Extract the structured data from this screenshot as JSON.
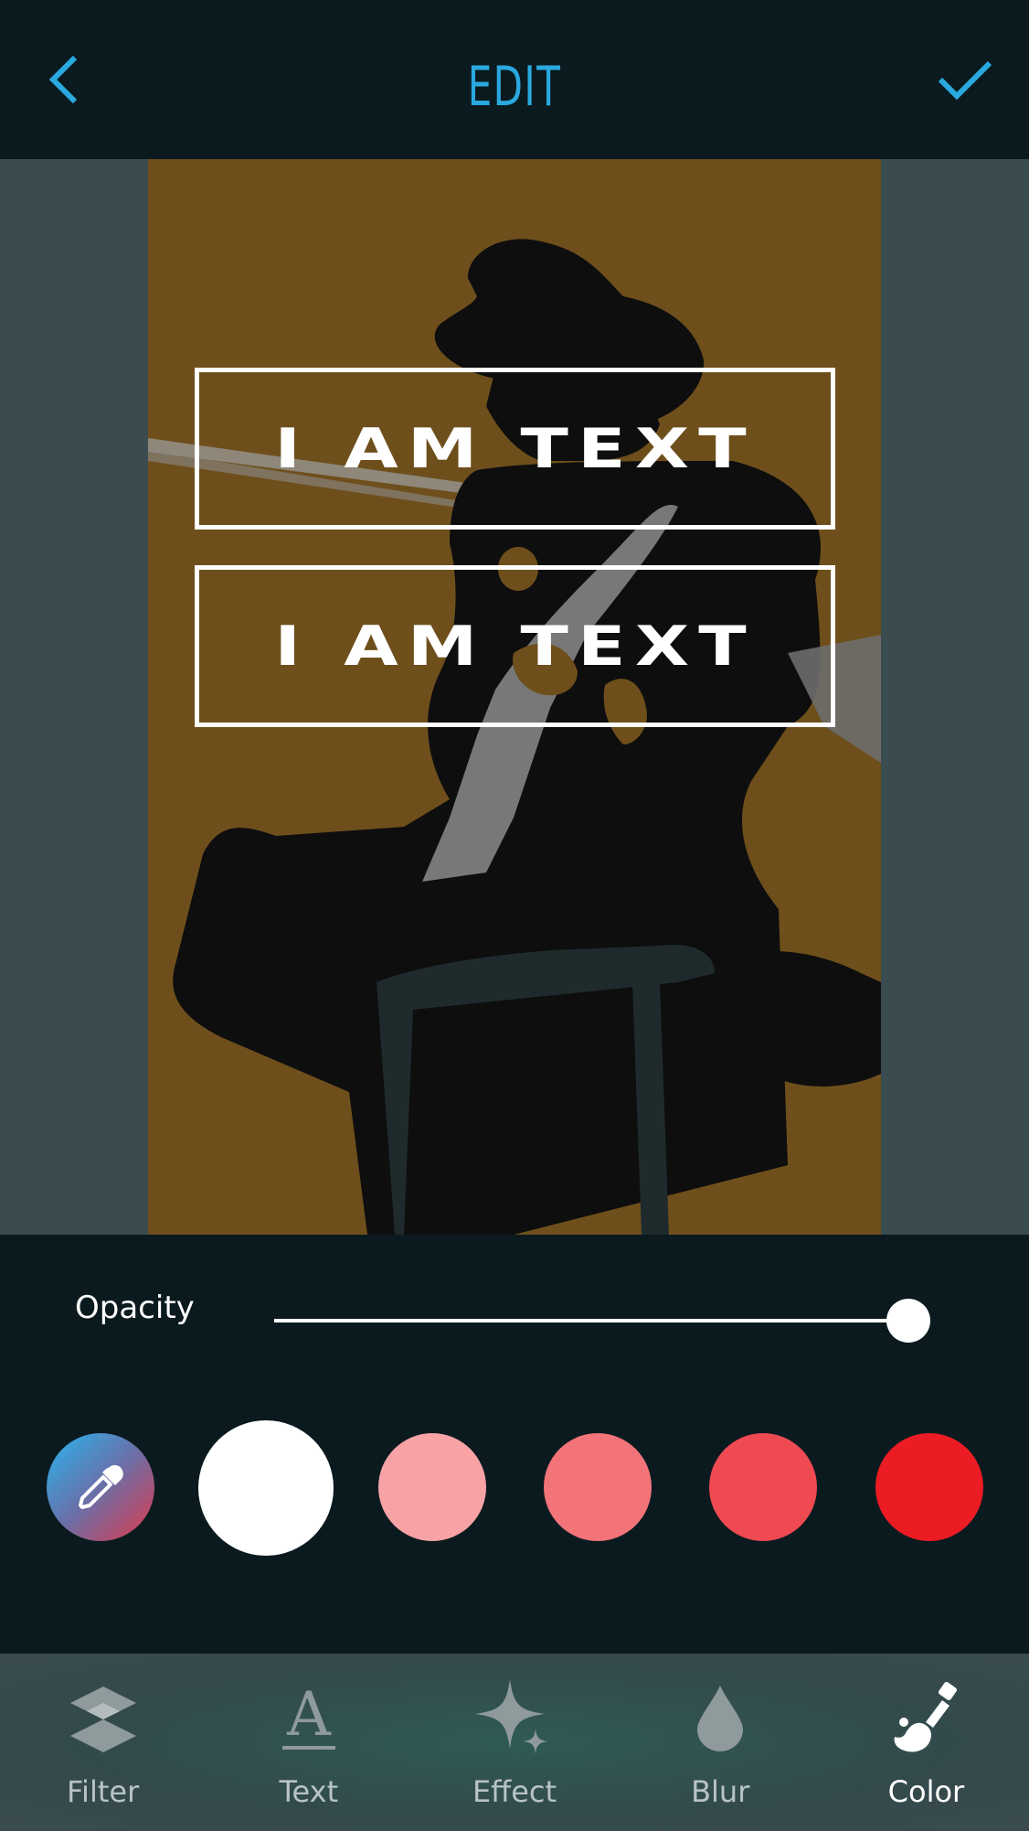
{
  "header": {
    "title": "EDIT",
    "back_icon": "chevron-left-icon",
    "done_icon": "checkmark-icon",
    "accent_color": "#29a9df"
  },
  "canvas": {
    "background_color": "#6e4f1c",
    "text_layers": [
      {
        "text": "I AM TEXT"
      },
      {
        "text": "I AM TEXT"
      }
    ]
  },
  "controls": {
    "opacity_label": "Opacity",
    "opacity_value": 1.0,
    "color_picker_icon": "eyedropper-icon",
    "swatches": [
      {
        "color": "#ffffff",
        "selected": true
      },
      {
        "color": "#f7a3a6",
        "selected": false
      },
      {
        "color": "#f27479",
        "selected": false
      },
      {
        "color": "#ef4a52",
        "selected": false
      },
      {
        "color": "#ec1c24",
        "selected": false
      }
    ]
  },
  "bottom_nav": {
    "items": [
      {
        "label": "Filter",
        "icon": "layers-icon",
        "active": false
      },
      {
        "label": "Text",
        "icon": "text-icon",
        "active": false
      },
      {
        "label": "Effect",
        "icon": "sparkle-icon",
        "active": false
      },
      {
        "label": "Blur",
        "icon": "droplet-icon",
        "active": false
      },
      {
        "label": "Color",
        "icon": "paint-brush-icon",
        "active": true
      }
    ]
  }
}
